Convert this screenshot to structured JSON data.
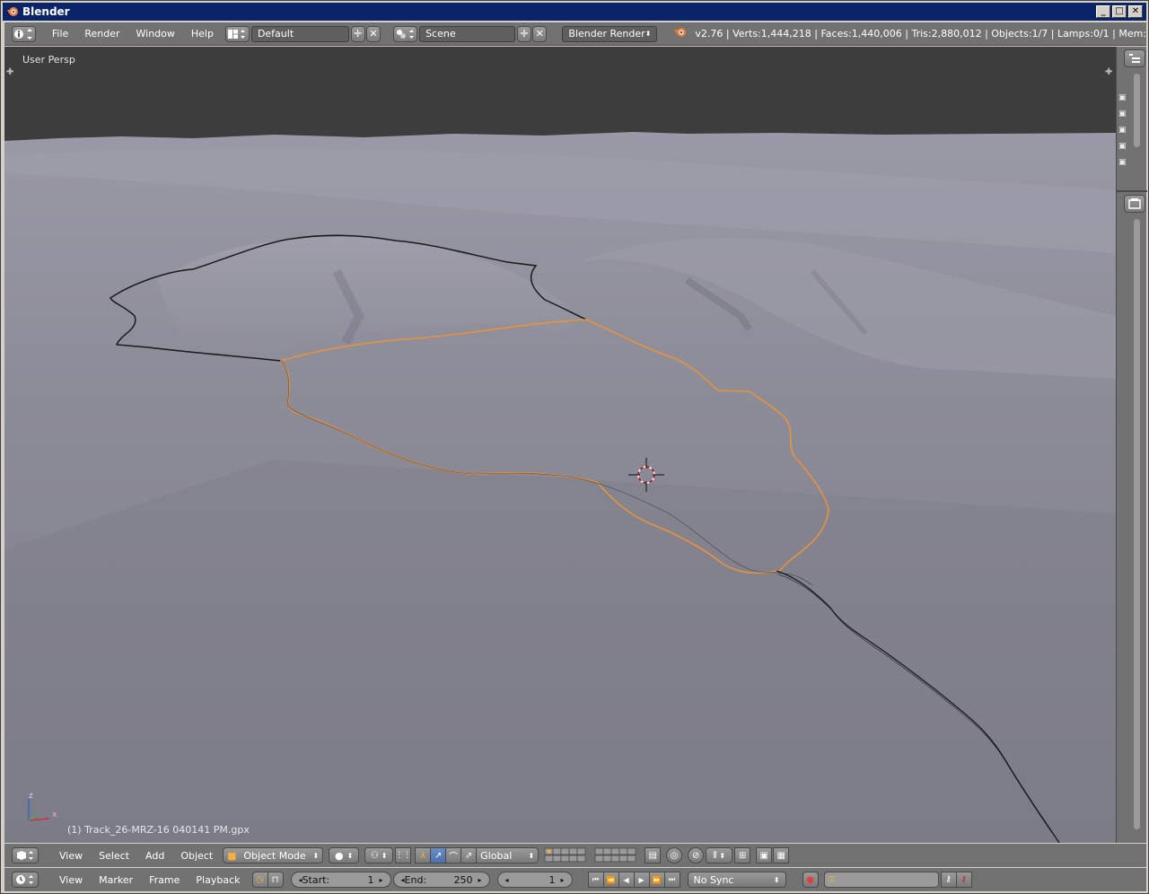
{
  "window": {
    "title": "Blender"
  },
  "info_header": {
    "menus": [
      "File",
      "Render",
      "Window",
      "Help"
    ],
    "screen_layout": "Default",
    "scene": "Scene",
    "render_engine": "Blender Render",
    "stats": "v2.76 | Verts:1,444,218 | Faces:1,440,006 | Tris:2,880,012 | Objects:1/7 | Lamps:0/1 | Mem:"
  },
  "viewport": {
    "view_label": "User Persp",
    "active_object": "(1) Track_26-MRZ-16 040141 PM.gpx",
    "axis_z": "z",
    "axis_x": "x",
    "colors": {
      "sky": "#3d3d3d",
      "terrain": "#868592",
      "selected_track": "#e8923a",
      "track": "#1a1a1a"
    }
  },
  "view3d_header": {
    "menus": [
      "View",
      "Select",
      "Add",
      "Object"
    ],
    "mode": "Object Mode",
    "orientation": "Global"
  },
  "timeline_header": {
    "menus": [
      "View",
      "Marker",
      "Frame",
      "Playback"
    ],
    "start_label": "Start:",
    "start_value": "1",
    "end_label": "End:",
    "end_value": "250",
    "current_frame": "1",
    "sync": "No Sync"
  }
}
